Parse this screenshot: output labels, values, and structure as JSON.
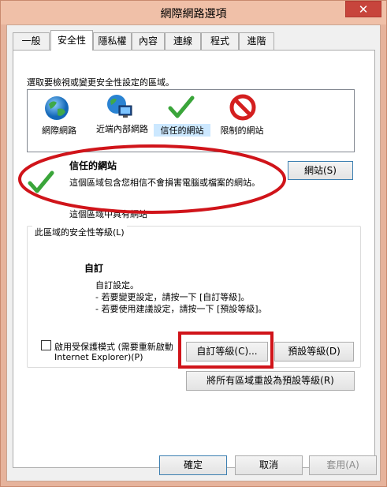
{
  "window": {
    "title": "網際網路選項",
    "close_glyph": "✕"
  },
  "tabs": [
    {
      "label": "一般"
    },
    {
      "label": "安全性"
    },
    {
      "label": "隱私權"
    },
    {
      "label": "內容"
    },
    {
      "label": "連線"
    },
    {
      "label": "程式"
    },
    {
      "label": "進階"
    }
  ],
  "security": {
    "prompt": "選取要檢視或變更安全性設定的區域。",
    "zones": [
      {
        "label": "網際網路",
        "icon": "globe-icon"
      },
      {
        "label": "近端內部網路",
        "icon": "intranet-icon"
      },
      {
        "label": "信任的網站",
        "icon": "checkmark-icon"
      },
      {
        "label": "限制的網站",
        "icon": "restricted-icon"
      }
    ],
    "selected_zone_title": "信任的網站",
    "selected_zone_desc": "這個區域包含您相信不會損害電腦或檔案的網站。",
    "sites_button": "網站(S)",
    "partial_hidden_text": "這個區域中具有網站",
    "level_group_label": "此區域的安全性等級(L)",
    "level_name": "自訂",
    "level_lines": [
      "自訂設定。",
      "- 若要變更設定，請按一下 [自訂等級]。",
      "- 若要使用建議設定，請按一下 [預設等級]。"
    ],
    "protected_mode_line1": "啟用受保護模式 (需要重新啟動",
    "protected_mode_line2": "Internet Explorer)(P)",
    "protected_mode_checked": false,
    "custom_level_button": "自訂等級(C)...",
    "default_level_button": "預設等級(D)",
    "reset_all_button": "將所有區域重設為預設等級(R)"
  },
  "footer": {
    "ok": "確定",
    "cancel": "取消",
    "apply": "套用(A)"
  },
  "colors": {
    "annotation_red": "#d0141a",
    "selected_zone_highlight": "#cce8ff"
  }
}
